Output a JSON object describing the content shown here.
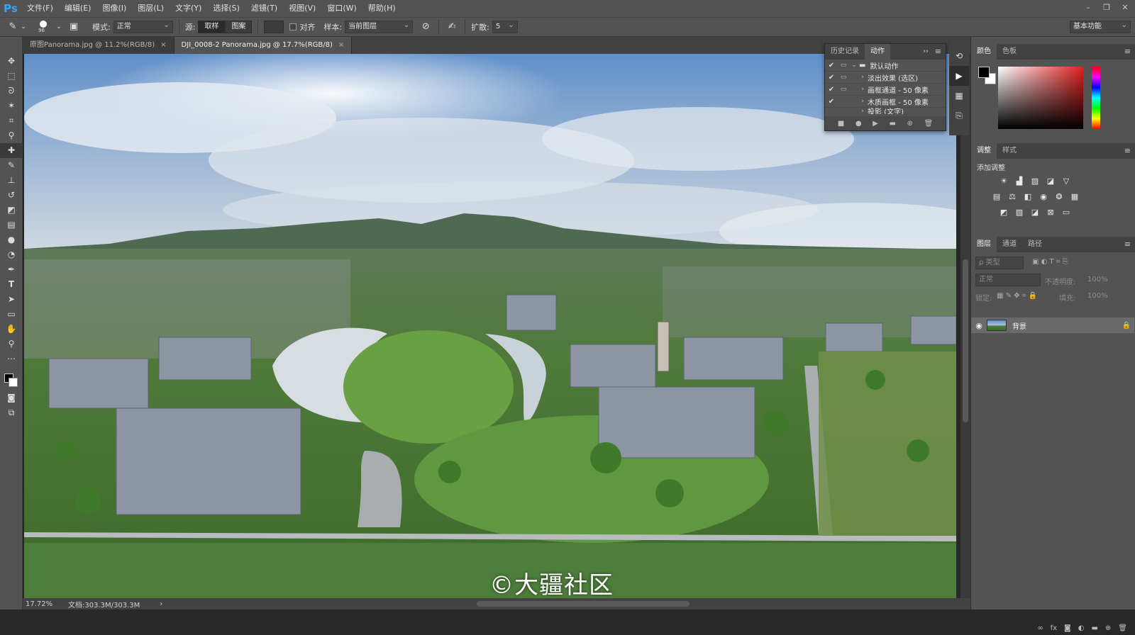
{
  "app": {
    "logo": "Ps"
  },
  "menu": [
    "文件(F)",
    "编辑(E)",
    "图像(I)",
    "图层(L)",
    "文字(Y)",
    "选择(S)",
    "滤镜(T)",
    "视图(V)",
    "窗口(W)",
    "帮助(H)"
  ],
  "window_controls": {
    "minimize": "–",
    "restore": "❐",
    "close": "✕"
  },
  "options": {
    "brush_size": "96",
    "mode_label": "模式:",
    "mode_value": "正常",
    "source_label": "源:",
    "sampled_btn": "取样",
    "pattern_btn": "图案",
    "aligned_label": "对齐",
    "sample_label": "样本:",
    "sample_value": "当前图层",
    "diffusion_label": "扩散:",
    "diffusion_value": "5",
    "workspace": "基本功能"
  },
  "tabs": [
    {
      "label": "原图Panorama.jpg @ 11.2%(RGB/8)",
      "close": "×"
    },
    {
      "label": "DJI_0008-2 Panorama.jpg @ 17.7%(RGB/8)",
      "close": "×"
    }
  ],
  "watermark": "©大疆社区",
  "status": {
    "zoom": "17.72%",
    "doc": "文档:303.3M/303.3M",
    "arrow": "›"
  },
  "actions_panel": {
    "tab_history": "历史记录",
    "tab_actions": "动作",
    "expand": "››",
    "menu": "≡",
    "rows": [
      {
        "check": "✔",
        "dlg": "▭",
        "arrow": "⌄",
        "label": "默认动作"
      },
      {
        "check": "✔",
        "dlg": "▭",
        "arrow": "›",
        "label": "淡出效果 (选区)"
      },
      {
        "check": "✔",
        "dlg": "▭",
        "arrow": "›",
        "label": "画框通道 - 50 像素"
      },
      {
        "check": "✔",
        "dlg": "",
        "arrow": "›",
        "label": "木质画框 - 50 像素"
      },
      {
        "check": "",
        "dlg": "",
        "arrow": "›",
        "label": "投影 (文字)"
      }
    ],
    "footer": [
      "■",
      "●",
      "▶",
      "▬",
      "⊕",
      "🗑"
    ]
  },
  "right": {
    "color_tab": "颜色",
    "swatches_tab": "色板",
    "adjust_tab": "调整",
    "styles_tab": "样式",
    "add_adjustment": "添加调整",
    "layers_tab": "图层",
    "channels_tab": "通道",
    "paths_tab": "路径",
    "filter_kind": "ρ 类型",
    "blend_mode": "正常",
    "opacity_label": "不透明度:",
    "opacity_value": "100%",
    "lock_label": "锁定:",
    "fill_label": "填充:",
    "fill_value": "100%",
    "layer_name": "背景",
    "menu": "≡"
  }
}
